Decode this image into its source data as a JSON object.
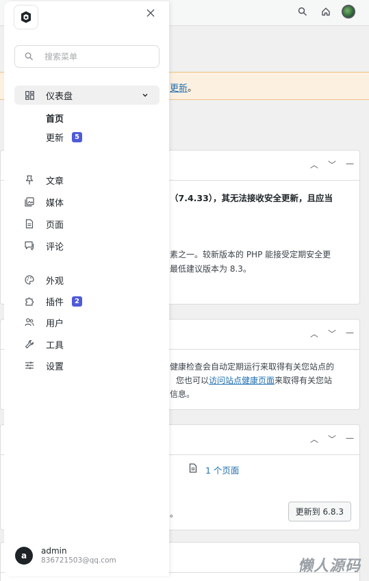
{
  "drawer": {
    "search_placeholder": "搜索菜单",
    "menu": [
      {
        "label": "仪表盘",
        "icon": "dashboard-icon"
      },
      {
        "label": "首页"
      },
      {
        "label": "更新",
        "badge": "5"
      },
      {
        "label": "文章",
        "icon": "pin-icon"
      },
      {
        "label": "媒体",
        "icon": "media-icon"
      },
      {
        "label": "页面",
        "icon": "page-icon"
      },
      {
        "label": "评论",
        "icon": "comment-icon"
      },
      {
        "label": "外观",
        "icon": "palette-icon"
      },
      {
        "label": "插件",
        "icon": "plugin-icon",
        "badge": "2"
      },
      {
        "label": "用户",
        "icon": "users-icon"
      },
      {
        "label": "工具",
        "icon": "wrench-icon"
      },
      {
        "label": "设置",
        "icon": "sliders-icon"
      }
    ],
    "user": {
      "initial": "a",
      "name": "admin",
      "email": "836721503@qq.com"
    }
  },
  "background": {
    "notice_link": "更新",
    "notice_tail": "。",
    "php_title": "（7.4.33），其无法接收安全更新，且应当",
    "php_line1": "素之一。较新版本的 PHP 能接受定期安全更",
    "php_line2": "最低建议版本为 8.3。",
    "health_line1": "健康检查会自动定期运行来取得有关您站点的",
    "health_line2_pre": "您也可以",
    "health_line2_link": "访问站点健康页面",
    "health_line2_post": "来取得有关您站",
    "health_line3": "信息。",
    "pages_link": "1 个页面",
    "update_button": "更新到 6.8.3",
    "period": "。"
  },
  "watermark": "懒人源码",
  "colors": {
    "accent": "#4f5ad9",
    "link": "#2271b1",
    "notice_bg": "#fcf0e1"
  }
}
